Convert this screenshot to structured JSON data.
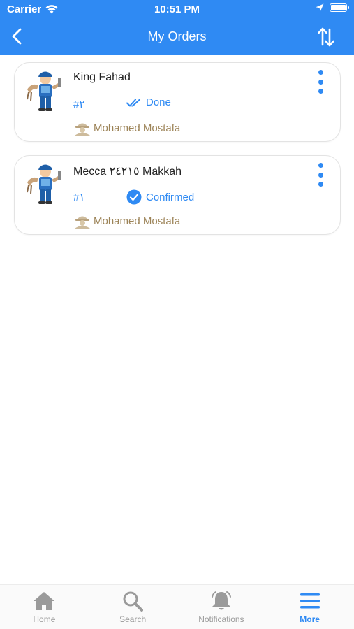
{
  "status_bar": {
    "carrier": "Carrier",
    "time": "10:51 PM"
  },
  "header": {
    "title": "My Orders",
    "back_icon": "chevron-left-icon",
    "sort_icon": "sort-arrows-icon"
  },
  "colors": {
    "accent": "#2f8af3",
    "worker": "#9c8357",
    "tab_inactive": "#9a9a9a"
  },
  "orders": [
    {
      "title": "King Fahad",
      "number": "#٢",
      "status": "Done",
      "status_icon": "double-check-icon",
      "worker": "Mohamed Mostafa"
    },
    {
      "title": "Mecca ٢٤٢١٥ Makkah",
      "number": "#١",
      "status": "Confirmed",
      "status_icon": "check-circle-icon",
      "worker": "Mohamed Mostafa"
    }
  ],
  "tabs": [
    {
      "label": "Home",
      "icon": "home-icon",
      "active": false
    },
    {
      "label": "Search",
      "icon": "search-icon",
      "active": false
    },
    {
      "label": "Notifications",
      "icon": "bell-icon",
      "active": false
    },
    {
      "label": "More",
      "icon": "menu-icon",
      "active": true
    }
  ]
}
